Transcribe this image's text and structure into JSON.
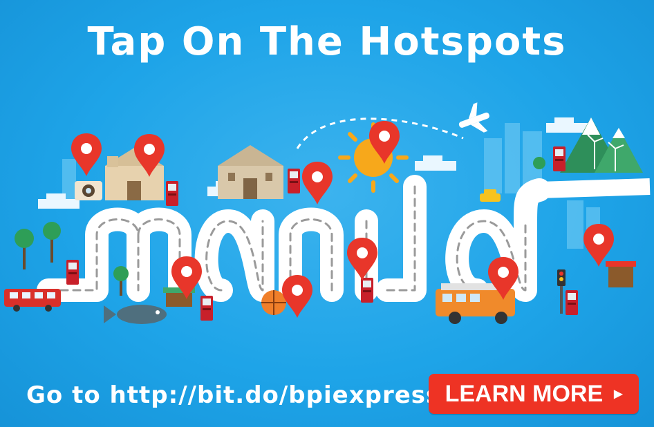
{
  "banner": {
    "title": "Tap On The Hotspots",
    "footer_text": "Go to http://bit.do/bpiexpress",
    "cta_label": "LEARN MORE",
    "cta_icon": "play-triangle-icon",
    "hero_word": "manila"
  },
  "colors": {
    "background": "#1ea4e8",
    "pin": "#e8362a",
    "cta": "#ee3324",
    "text": "#ffffff"
  }
}
